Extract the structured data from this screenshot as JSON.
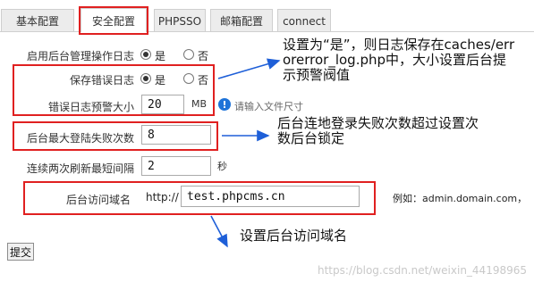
{
  "tabs": [
    {
      "label": "基本配置"
    },
    {
      "label": "安全配置"
    },
    {
      "label": "PHPSSO"
    },
    {
      "label": "邮箱配置"
    },
    {
      "label": "connect"
    }
  ],
  "rows": {
    "admin_log": {
      "label": "启用后台管理操作日志",
      "yes": "是",
      "no": "否"
    },
    "error_log": {
      "label": "保存错误日志",
      "yes": "是",
      "no": "否"
    },
    "error_log_size": {
      "label": "错误日志预警大小",
      "value": "20",
      "unit": "MB",
      "hint": "请输入文件尺寸"
    },
    "max_login_fail": {
      "label": "后台最大登陆失败次数",
      "value": "8"
    },
    "min_refresh": {
      "label": "连续两次刷新最短间隔",
      "value": "2",
      "unit": "秒"
    },
    "admin_domain": {
      "label": "后台访问域名",
      "prefix": "http://",
      "value": "test.phpcms.cn",
      "example": "例如：admin.domain.com，"
    }
  },
  "annotations": {
    "note1": "设置为“是”，则日志保存在caches/error/error_log.php中，大小设置后台提示预警阀值",
    "note1_line1": "设置为“是”，则日志保存在caches/err",
    "note1_line2": "orerror_log.php中，大小设置后台提",
    "note1_line3": "示预警阀值",
    "note2_line1": "后台连地登录失败次数超过设置次",
    "note2_line2": "数后台锁定",
    "note3": "设置后台访问域名",
    "color": "#e02020",
    "arrow_color": "#1e5fd8"
  },
  "submit_label": "提交",
  "watermark": "https://blog.csdn.net/weixin_44198965"
}
